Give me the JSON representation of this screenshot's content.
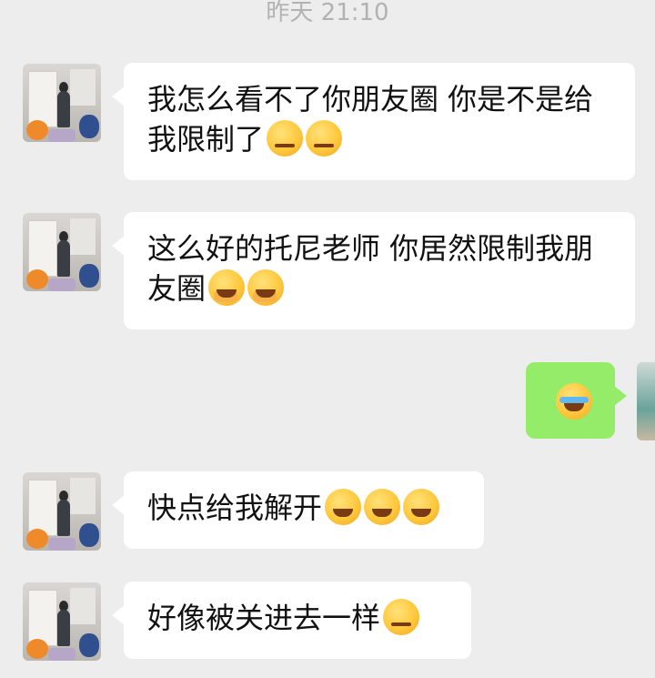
{
  "chat": {
    "timestamp": "昨天 21:10",
    "messages": [
      {
        "sender": "other",
        "text": "我怎么看不了你朋友圈 你是不是给我限制了",
        "emojis": [
          "smirk-emoji",
          "smirk-emoji"
        ]
      },
      {
        "sender": "other",
        "text": "这么好的托尼老师 你居然限制我朋友圈",
        "emojis": [
          "facepalm-emoji",
          "facepalm-emoji"
        ]
      },
      {
        "sender": "me",
        "text": "",
        "emojis": [
          "tears-of-joy-emoji"
        ]
      },
      {
        "sender": "other",
        "text": "快点给我解开",
        "emojis": [
          "grin-squint-emoji",
          "grin-squint-emoji",
          "grin-squint-emoji"
        ]
      },
      {
        "sender": "other",
        "text": "好像被关进去一样",
        "emojis": [
          "drooling-emoji"
        ]
      }
    ]
  },
  "colors": {
    "background": "#ededed",
    "incoming_bubble": "#ffffff",
    "outgoing_bubble": "#95ec69",
    "timestamp_text": "#b2b2b2"
  }
}
